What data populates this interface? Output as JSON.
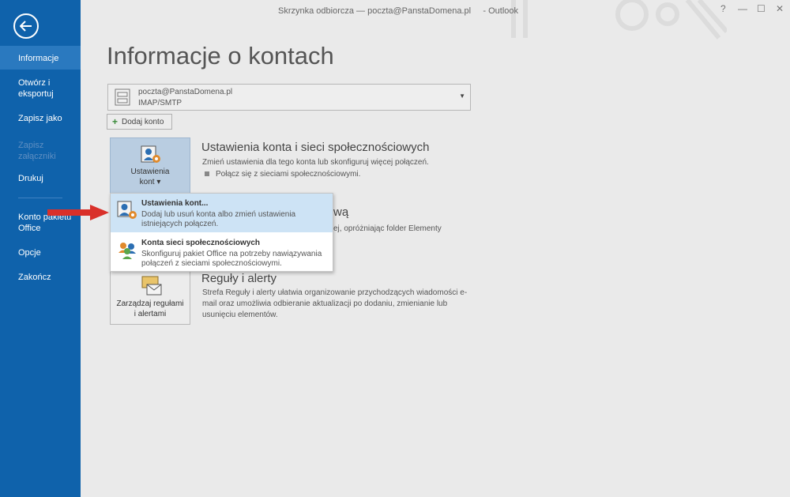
{
  "window": {
    "title": "Skrzynka odbiorcza — poczta@PanstaDomena.pl     - Outlook",
    "help": "?",
    "minimize": "—",
    "maximize": "☐",
    "close": "✕"
  },
  "sidebar": {
    "items": [
      {
        "label": "Informacje",
        "state": "active"
      },
      {
        "label": "Otwórz i eksportuj",
        "state": "normal"
      },
      {
        "label": "Zapisz jako",
        "state": "normal"
      },
      {
        "label": "Zapisz załączniki",
        "state": "disabled"
      },
      {
        "label": "Drukuj",
        "state": "normal"
      },
      {
        "label": "Konto pakietu Office",
        "state": "normal"
      },
      {
        "label": "Opcje",
        "state": "normal"
      },
      {
        "label": "Zakończ",
        "state": "normal"
      }
    ]
  },
  "main": {
    "title": "Informacje o kontach",
    "account": {
      "email": "poczta@PanstaDomena.pl",
      "type": "IMAP/SMTP"
    },
    "add_account_label": "Dodaj konto",
    "settings_tile": {
      "line1": "Ustawienia",
      "line2": "kont ▾"
    },
    "settings_section": {
      "title": "Ustawienia konta i sieci społecznościowych",
      "desc": "Zmień ustawienia dla tego konta lub skonfiguruj więcej połączeń.",
      "bullet": "Połącz się z sieciami społecznościowymi."
    },
    "cleanup_section": {
      "title_tail": "wą",
      "desc_tail": "ej, opróżniając folder Elementy"
    },
    "rules_tile": {
      "line1": "Zarządzaj regułami",
      "line2": "i alertami"
    },
    "rules_section": {
      "title": "Reguły i alerty",
      "line1": "Strefa Reguły i alerty ułatwia organizowanie przychodzących wiadomości e-",
      "line2": "mail oraz umożliwia odbieranie aktualizacji po dodaniu, zmienianie lub",
      "line3": "usunięciu elementów."
    }
  },
  "dropdown": {
    "items": [
      {
        "title": "Ustawienia kont...",
        "desc1": "Dodaj lub usuń konta albo zmień ustawienia",
        "desc2": "istniejących połączeń."
      },
      {
        "title": "Konta sieci społecznościowych",
        "desc1": "Skonfiguruj pakiet Office na potrzeby nawiązywania",
        "desc2": "połączeń z sieciami społecznościowymi."
      }
    ]
  },
  "colors": {
    "sidebar": "#0f62ab",
    "sidebar_active": "#2a79bf",
    "menu_highlight": "#cde3f5",
    "arrow": "#d9302a"
  }
}
